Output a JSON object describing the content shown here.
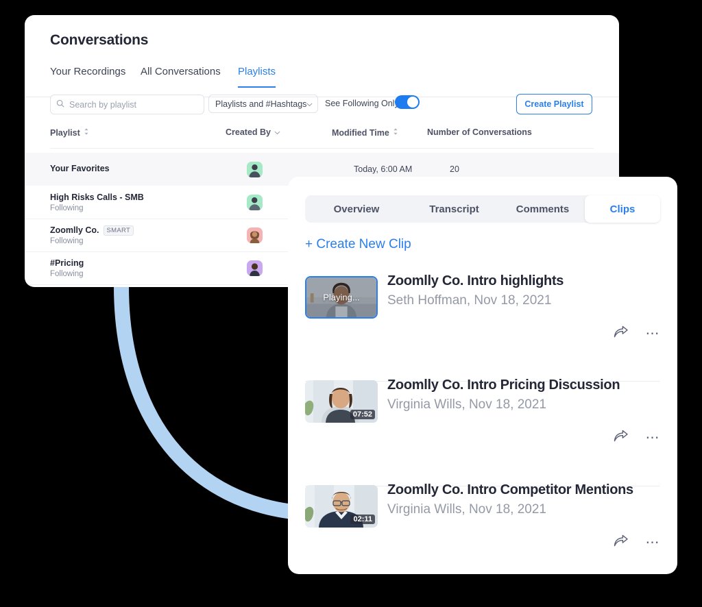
{
  "colors": {
    "accent": "#2a7fea",
    "toggle_on": "#1f7cf0",
    "arc": "#b3d3f2",
    "text_dark": "#232736",
    "text_muted": "#9499a6",
    "background": "#000000"
  },
  "back_card": {
    "title": "Conversations",
    "tabs": [
      {
        "label": "Your Recordings",
        "active": false
      },
      {
        "label": "All Conversations",
        "active": false
      },
      {
        "label": "Playlists",
        "active": true
      }
    ],
    "toolbar": {
      "search_placeholder": "Search by playlist",
      "search_value": "",
      "search_icon": "search-icon",
      "filter_label": "Playlists and #Hashtags",
      "filter_icon": "chevron-down-icon",
      "toggle_label": "See Following Only",
      "toggle_state": "on",
      "create_button": "Create Playlist"
    },
    "table": {
      "columns": [
        {
          "label": "Playlist",
          "sort_icon": "sort-updown-icon"
        },
        {
          "label": "Created By",
          "sort_icon": "chevron-down-icon"
        },
        {
          "label": "Modified Time",
          "sort_icon": "sort-updown-icon"
        },
        {
          "label": "Number of Conversations",
          "sort_icon": ""
        }
      ],
      "rows": [
        {
          "name": "Your Favorites",
          "badge": "",
          "sub": "",
          "avatar_color": "#a6e9c6",
          "modified": "Today, 6:00 AM",
          "count": "20",
          "highlighted": true
        },
        {
          "name": "High Risks Calls - SMB",
          "badge": "",
          "sub": "Following",
          "avatar_color": "#a6e9c6",
          "modified": "",
          "count": "",
          "highlighted": false
        },
        {
          "name": "Zoomlly Co.",
          "badge": "SMART",
          "sub": "Following",
          "avatar_color": "#f5b4b4",
          "modified": "",
          "count": "",
          "highlighted": false
        },
        {
          "name": "#Pricing",
          "badge": "",
          "sub": "Following",
          "avatar_color": "#c9a8f0",
          "modified": "",
          "count": "",
          "highlighted": false
        }
      ]
    }
  },
  "front_card": {
    "tabs": [
      {
        "label": "Overview",
        "active": false
      },
      {
        "label": "Transcript",
        "active": false
      },
      {
        "label": "Comments",
        "active": false
      },
      {
        "label": "Clips",
        "active": true
      }
    ],
    "create_clip": "+ Create New Clip",
    "clips": [
      {
        "title": "Zoomlly Co. Intro highlights",
        "meta": "Seth Hoffman, Nov 18, 2021",
        "badge": "Playing...",
        "duration": "",
        "state": "playing",
        "share_icon": "share-arrow-icon",
        "more_icon": "more-horizontal-icon"
      },
      {
        "title": "Zoomlly Co. Intro Pricing Discussion",
        "meta": "Virginia Wills, Nov 18, 2021",
        "badge": "",
        "duration": "07:52",
        "state": "idle",
        "share_icon": "share-arrow-icon",
        "more_icon": "more-horizontal-icon"
      },
      {
        "title": "Zoomlly Co. Intro Competitor Mentions",
        "meta": "Virginia Wills, Nov 18, 2021",
        "badge": "",
        "duration": "02:11",
        "state": "idle",
        "share_icon": "share-arrow-icon",
        "more_icon": "more-horizontal-icon"
      }
    ]
  }
}
